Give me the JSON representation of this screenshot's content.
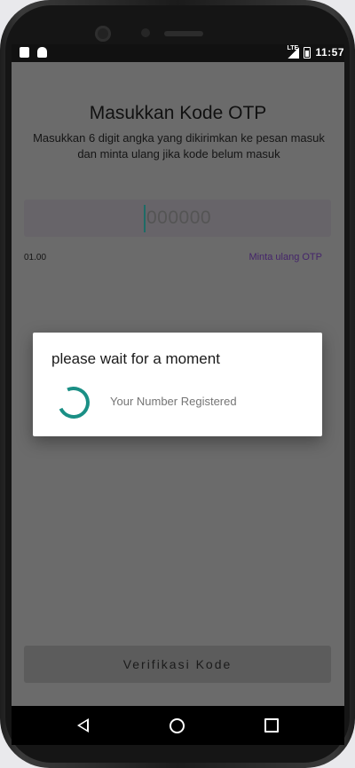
{
  "status_bar": {
    "time": "11:57",
    "network": "LTE",
    "left_icons": [
      "notification-icon",
      "android-icon"
    ]
  },
  "page": {
    "title": "Masukkan Kode OTP",
    "subtitle": "Masukkan 6 digit angka yang dikirimkan ke pesan masuk dan minta ulang jika kode belum masuk",
    "otp_placeholder": "000000",
    "otp_value": "",
    "timer": "01.00",
    "resend_label": "Minta ulang OTP",
    "verify_label": "Verifikasi Kode"
  },
  "dialog": {
    "title": "please wait for a moment",
    "message": "Your Number Registered"
  },
  "colors": {
    "accent": "#1a8f85",
    "link": "#45256b",
    "overlay": "#6b6b6b"
  },
  "nav": {
    "icons": [
      "back-icon",
      "home-icon",
      "recent-apps-icon"
    ]
  }
}
